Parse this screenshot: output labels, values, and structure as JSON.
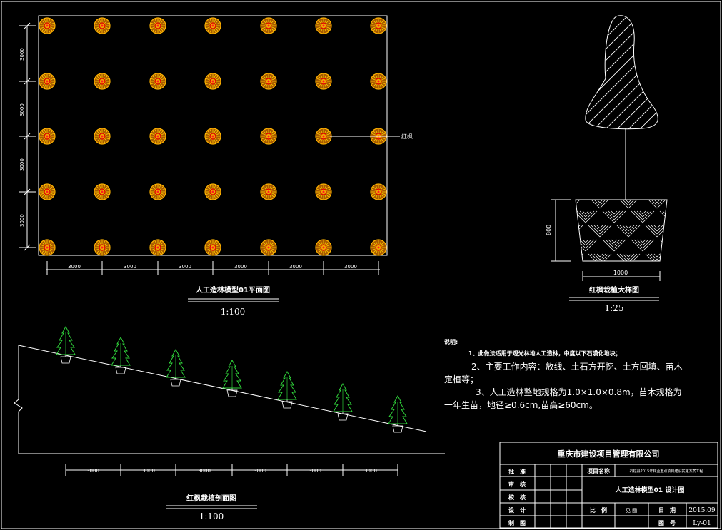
{
  "plan": {
    "title": "人工造林模型01平面图",
    "scale": "1:100",
    "tree_label": "红枫",
    "dim_bottom": [
      "3000",
      "3000",
      "3000",
      "3000",
      "3000",
      "3000"
    ],
    "dim_left": [
      "3000",
      "3000",
      "3000",
      "3000"
    ]
  },
  "detail": {
    "title": "红枫栽植大样图",
    "scale": "1:25",
    "dim_height": "800",
    "dim_width": "1000"
  },
  "section": {
    "title": "红枫栽植剖面图",
    "scale": "1:100",
    "dims": [
      "3000",
      "3000",
      "3000",
      "3000",
      "3000",
      "3000"
    ]
  },
  "notes": {
    "heading": "说明:",
    "line1": "1、此做法适用于观光林地人工造林，中度以下石漠化地块；",
    "line2a": "2、主要工作内容：放线、土石方开挖、土方回填、苗木",
    "line2b": "定植等；",
    "line3a": "3、人工造林整地规格为1.0×1.0×0.8m，苗木规格为",
    "line3b": "一年生苗，地径≥0.6cm,苗高≥60cm。"
  },
  "title_block": {
    "company": "重庆市建设项目管理有限公司",
    "approve": "批　准",
    "review": "审　核",
    "check": "校　核",
    "design": "设　计",
    "draw": "制　图",
    "project_name_label": "项目名称",
    "project_name": "石柱县2015年林业重点项目建设实施方案工程",
    "drawing_title": "人工造林模型01 设计图",
    "scale_label": "比　例",
    "scale_value": "见 图",
    "date_label": "日　期",
    "date_value": "2015.09",
    "drawing_no_label": "图　号",
    "drawing_no_value": "Ly-01"
  }
}
